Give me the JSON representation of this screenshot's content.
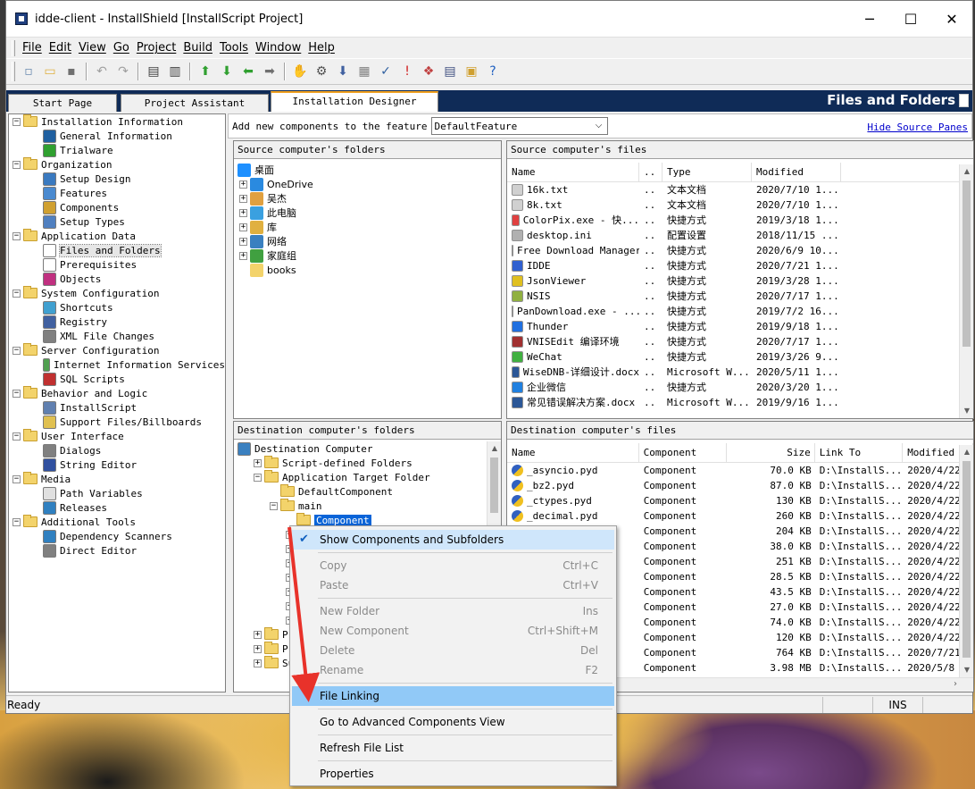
{
  "window": {
    "title": "idde-client - InstallShield [InstallScript Project]",
    "minimize": "─",
    "maximize": "☐",
    "close": "✕"
  },
  "menu": [
    "File",
    "Edit",
    "View",
    "Go",
    "Project",
    "Build",
    "Tools",
    "Window",
    "Help"
  ],
  "toolbar_icons": [
    "new-file-icon",
    "open-folder-icon",
    "save-icon",
    "undo-icon",
    "redo-icon",
    "panel-left-icon",
    "panel-split-icon",
    "arrow-up-icon",
    "arrow-down-icon",
    "arrow-left-icon",
    "arrow-right-icon",
    "hand-icon",
    "build-icon",
    "release-icon",
    "compile-icon",
    "validate-icon",
    "error-icon",
    "debug-icon",
    "options-icon",
    "package-icon",
    "help-icon"
  ],
  "tabs": {
    "start_page": "Start Page",
    "project_assistant": "Project Assistant",
    "installation_designer": "Installation Designer"
  },
  "section_title": "Files and Folders",
  "left_tree": [
    {
      "label": "Installation Information",
      "level": 0,
      "type": "folder"
    },
    {
      "label": "General Information",
      "level": 1,
      "type": "item",
      "icon": "general-info-icon",
      "color": "#2060a0"
    },
    {
      "label": "Trialware",
      "level": 1,
      "type": "item",
      "icon": "trialware-icon",
      "color": "#30a030"
    },
    {
      "label": "Organization",
      "level": 0,
      "type": "folder"
    },
    {
      "label": "Setup Design",
      "level": 1,
      "type": "item",
      "icon": "setup-design-icon",
      "color": "#3a7ac0"
    },
    {
      "label": "Features",
      "level": 1,
      "type": "item",
      "icon": "features-icon",
      "color": "#4a8ad0"
    },
    {
      "label": "Components",
      "level": 1,
      "type": "item",
      "icon": "components-icon",
      "color": "#d0a030"
    },
    {
      "label": "Setup Types",
      "level": 1,
      "type": "item",
      "icon": "setup-types-icon",
      "color": "#5080c0"
    },
    {
      "label": "Application Data",
      "level": 0,
      "type": "folder"
    },
    {
      "label": "Files and Folders",
      "level": 1,
      "type": "item",
      "icon": "files-folders-icon",
      "color": "#ffffff",
      "selected": true
    },
    {
      "label": "Prerequisites",
      "level": 1,
      "type": "item",
      "icon": "prerequisites-icon",
      "color": "#ffffff"
    },
    {
      "label": "Objects",
      "level": 1,
      "type": "item",
      "icon": "objects-icon",
      "color": "#c03080"
    },
    {
      "label": "System Configuration",
      "level": 0,
      "type": "folder"
    },
    {
      "label": "Shortcuts",
      "level": 1,
      "type": "item",
      "icon": "shortcuts-icon",
      "color": "#40a0d0"
    },
    {
      "label": "Registry",
      "level": 1,
      "type": "item",
      "icon": "registry-icon",
      "color": "#4060a0"
    },
    {
      "label": "XML File Changes",
      "level": 1,
      "type": "item",
      "icon": "xml-icon",
      "color": "#808080"
    },
    {
      "label": "Server Configuration",
      "level": 0,
      "type": "folder"
    },
    {
      "label": "Internet Information Services",
      "level": 1,
      "type": "item",
      "icon": "iis-icon",
      "color": "#50a050"
    },
    {
      "label": "SQL Scripts",
      "level": 1,
      "type": "item",
      "icon": "sql-icon",
      "color": "#c03030"
    },
    {
      "label": "Behavior and Logic",
      "level": 0,
      "type": "folder"
    },
    {
      "label": "InstallScript",
      "level": 1,
      "type": "item",
      "icon": "installscript-icon",
      "color": "#6080b0"
    },
    {
      "label": "Support Files/Billboards",
      "level": 1,
      "type": "item",
      "icon": "support-files-icon",
      "color": "#e0c050"
    },
    {
      "label": "User Interface",
      "level": 0,
      "type": "folder"
    },
    {
      "label": "Dialogs",
      "level": 1,
      "type": "item",
      "icon": "dialogs-icon",
      "color": "#808080"
    },
    {
      "label": "String Editor",
      "level": 1,
      "type": "item",
      "icon": "string-editor-icon",
      "color": "#3050a0"
    },
    {
      "label": "Media",
      "level": 0,
      "type": "folder"
    },
    {
      "label": "Path Variables",
      "level": 1,
      "type": "item",
      "icon": "path-variables-icon",
      "color": "#e0e0e0"
    },
    {
      "label": "Releases",
      "level": 1,
      "type": "item",
      "icon": "releases-icon",
      "color": "#3080c0"
    },
    {
      "label": "Additional Tools",
      "level": 0,
      "type": "folder"
    },
    {
      "label": "Dependency Scanners",
      "level": 1,
      "type": "item",
      "icon": "dependency-scanners-icon",
      "color": "#3080c0"
    },
    {
      "label": "Direct Editor",
      "level": 1,
      "type": "item",
      "icon": "direct-editor-icon",
      "color": "#808080"
    }
  ],
  "feature_bar": {
    "label": "Add new components to the feature",
    "selected": "DefaultFeature",
    "hide_link": "Hide Source Panes"
  },
  "source_folders": {
    "header": "Source computer's folders",
    "items": [
      {
        "label": "桌面",
        "level": 0,
        "expander": "",
        "icon": "desktop-icon",
        "color": "#1e90ff"
      },
      {
        "label": "OneDrive",
        "level": 1,
        "expander": "+",
        "icon": "onedrive-icon",
        "color": "#2a8ae0"
      },
      {
        "label": "吴杰",
        "level": 1,
        "expander": "+",
        "icon": "user-icon",
        "color": "#e0a040"
      },
      {
        "label": "此电脑",
        "level": 1,
        "expander": "+",
        "icon": "computer-icon",
        "color": "#3aa0e0"
      },
      {
        "label": "库",
        "level": 1,
        "expander": "+",
        "icon": "library-icon",
        "color": "#e0b040"
      },
      {
        "label": "网络",
        "level": 1,
        "expander": "+",
        "icon": "network-icon",
        "color": "#3a80c0"
      },
      {
        "label": "家庭组",
        "level": 1,
        "expander": "+",
        "icon": "homegroup-icon",
        "color": "#40a040"
      },
      {
        "label": "books",
        "level": 1,
        "expander": "",
        "icon": "folder-icon",
        "color": "#f3d36b"
      }
    ]
  },
  "source_files": {
    "header": "Source computer's files",
    "columns": [
      "Name",
      "..",
      "Type",
      "Modified"
    ],
    "rows": [
      {
        "name": "16k.txt",
        "dots": "..",
        "type": "文本文档",
        "modified": "2020/7/10 1...",
        "icon": "text-file-icon",
        "color": "#d0d0d0"
      },
      {
        "name": "8k.txt",
        "dots": "..",
        "type": "文本文档",
        "modified": "2020/7/10 1...",
        "icon": "text-file-icon",
        "color": "#d0d0d0"
      },
      {
        "name": "ColorPix.exe - 快...",
        "dots": "..",
        "type": "快捷方式",
        "modified": "2019/3/18 1...",
        "icon": "colorpix-icon",
        "color": "#e04040"
      },
      {
        "name": "desktop.ini",
        "dots": "..",
        "type": "配置设置",
        "modified": "2018/11/15 ...",
        "icon": "ini-file-icon",
        "color": "#b0b0b0"
      },
      {
        "name": "Free Download Manager",
        "dots": "..",
        "type": "快捷方式",
        "modified": "2020/6/9 10...",
        "icon": "fdm-icon",
        "color": "#ffffff"
      },
      {
        "name": "IDDE",
        "dots": "..",
        "type": "快捷方式",
        "modified": "2020/7/21 1...",
        "icon": "idde-icon",
        "color": "#3060d0"
      },
      {
        "name": "JsonViewer",
        "dots": "..",
        "type": "快捷方式",
        "modified": "2019/3/28 1...",
        "icon": "jsonviewer-icon",
        "color": "#e0c020"
      },
      {
        "name": "NSIS",
        "dots": "..",
        "type": "快捷方式",
        "modified": "2020/7/17 1...",
        "icon": "nsis-icon",
        "color": "#90b040"
      },
      {
        "name": "PanDownload.exe - ...",
        "dots": "..",
        "type": "快捷方式",
        "modified": "2019/7/2 16...",
        "icon": "pandownload-icon",
        "color": "#40a0e0"
      },
      {
        "name": "Thunder",
        "dots": "..",
        "type": "快捷方式",
        "modified": "2019/9/18 1...",
        "icon": "thunder-icon",
        "color": "#2070e0"
      },
      {
        "name": "VNISEdit 编译环境",
        "dots": "..",
        "type": "快捷方式",
        "modified": "2020/7/17 1...",
        "icon": "vnisedit-icon",
        "color": "#a03030"
      },
      {
        "name": "WeChat",
        "dots": "..",
        "type": "快捷方式",
        "modified": "2019/3/26 9...",
        "icon": "wechat-icon",
        "color": "#40b040"
      },
      {
        "name": "WiseDNB-详细设计.docx",
        "dots": "..",
        "type": "Microsoft W...",
        "modified": "2020/5/11 1...",
        "icon": "word-icon",
        "color": "#2b5797"
      },
      {
        "name": "企业微信",
        "dots": "..",
        "type": "快捷方式",
        "modified": "2020/3/20 1...",
        "icon": "wework-icon",
        "color": "#2080e0"
      },
      {
        "name": "常见错误解决方案.docx",
        "dots": "..",
        "type": "Microsoft W...",
        "modified": "2019/9/16 1...",
        "icon": "word-icon",
        "color": "#2b5797"
      }
    ]
  },
  "dest_folders": {
    "header": "Destination computer's folders",
    "items": [
      {
        "label": "Destination Computer",
        "level": 0,
        "expander": "",
        "icon": "computer-icon",
        "color": "#3a80c0"
      },
      {
        "label": "Script-defined Folders",
        "level": 1,
        "expander": "+",
        "icon": "script-folder-icon",
        "color": "#f3d36b"
      },
      {
        "label": "Application Target Folder",
        "level": 1,
        "expander": "−",
        "icon": "target-folder-icon",
        "color": "#f3d36b"
      },
      {
        "label": "DefaultComponent",
        "level": 2,
        "expander": "",
        "icon": "folder-icon",
        "color": "#f3d36b"
      },
      {
        "label": "main",
        "level": 2,
        "expander": "−",
        "icon": "folder-icon",
        "color": "#f3d36b"
      },
      {
        "label": "Component",
        "level": 3,
        "expander": "",
        "icon": "folder-icon",
        "color": "#f3d36b",
        "selected": true
      },
      {
        "label": "",
        "level": 3,
        "expander": "+",
        "icon": "component-icon",
        "color": "#e0c020"
      },
      {
        "label": "",
        "level": 3,
        "expander": "+",
        "icon": "component-icon",
        "color": "#e0c020"
      },
      {
        "label": "",
        "level": 3,
        "expander": "+",
        "icon": "component-icon",
        "color": "#e0c020"
      },
      {
        "label": "",
        "level": 3,
        "expander": "+",
        "icon": "component-icon",
        "color": "#e0c020"
      },
      {
        "label": "",
        "level": 3,
        "expander": "+",
        "icon": "component-icon",
        "color": "#e0c020"
      },
      {
        "label": "",
        "level": 3,
        "expander": "+",
        "icon": "component-icon",
        "color": "#e0c020"
      },
      {
        "label": "",
        "level": 3,
        "expander": "+",
        "icon": "component-icon",
        "color": "#e0c020"
      },
      {
        "label": "Prog",
        "level": 1,
        "expander": "+",
        "icon": "folder-icon",
        "color": "#f3d36b"
      },
      {
        "label": "Prog",
        "level": 1,
        "expander": "+",
        "icon": "folder-icon",
        "color": "#f3d36b"
      },
      {
        "label": "Supp",
        "level": 1,
        "expander": "+",
        "icon": "folder-icon",
        "color": "#f3d36b"
      }
    ]
  },
  "dest_files": {
    "header": "Destination computer's files",
    "columns": [
      "Name",
      "Component",
      "Size",
      "Link To",
      "Modified"
    ],
    "rows": [
      {
        "name": "_asyncio.pyd",
        "component": "Component",
        "size": "70.0 KB",
        "link": "D:\\InstallS...",
        "modified": "2020/4/22"
      },
      {
        "name": "_bz2.pyd",
        "component": "Component",
        "size": "87.0 KB",
        "link": "D:\\InstallS...",
        "modified": "2020/4/22"
      },
      {
        "name": "_ctypes.pyd",
        "component": "Component",
        "size": "130 KB",
        "link": "D:\\InstallS...",
        "modified": "2020/4/22"
      },
      {
        "name": "_decimal.pyd",
        "component": "Component",
        "size": "260 KB",
        "link": "D:\\InstallS...",
        "modified": "2020/4/22"
      },
      {
        "name": "",
        "component": "Component",
        "size": "204 KB",
        "link": "D:\\InstallS...",
        "modified": "2020/4/22"
      },
      {
        "name": "",
        "component": "Component",
        "size": "38.0 KB",
        "link": "D:\\InstallS...",
        "modified": "2020/4/22"
      },
      {
        "name": "",
        "component": "Component",
        "size": "251 KB",
        "link": "D:\\InstallS...",
        "modified": "2020/4/22"
      },
      {
        "name": "yd",
        "component": "Component",
        "size": "28.5 KB",
        "link": "D:\\InstallS...",
        "modified": "2020/4/22"
      },
      {
        "name": "",
        "component": "Component",
        "size": "43.5 KB",
        "link": "D:\\InstallS...",
        "modified": "2020/4/22"
      },
      {
        "name": "",
        "component": "Component",
        "size": "27.0 KB",
        "link": "D:\\InstallS...",
        "modified": "2020/4/22"
      },
      {
        "name": "",
        "component": "Component",
        "size": "74.0 KB",
        "link": "D:\\InstallS...",
        "modified": "2020/4/22"
      },
      {
        "name": "",
        "component": "Component",
        "size": "120 KB",
        "link": "D:\\InstallS...",
        "modified": "2020/4/22"
      },
      {
        "name": "",
        "component": "Component",
        "size": "764 KB",
        "link": "D:\\InstallS...",
        "modified": "2020/7/21"
      },
      {
        "name": "",
        "component": "Component",
        "size": "3.98 MB",
        "link": "D:\\InstallS...",
        "modified": "2020/5/8"
      }
    ]
  },
  "context_menu": {
    "items": [
      {
        "label": "Show Components and Subfolders",
        "shortcut": "",
        "state": "checked"
      },
      {
        "sep": true
      },
      {
        "label": "Copy",
        "shortcut": "Ctrl+C",
        "state": "disabled"
      },
      {
        "label": "Paste",
        "shortcut": "Ctrl+V",
        "state": "disabled"
      },
      {
        "sep": true
      },
      {
        "label": "New Folder",
        "shortcut": "Ins",
        "state": "disabled"
      },
      {
        "label": "New Component",
        "shortcut": "Ctrl+Shift+M",
        "state": "disabled"
      },
      {
        "label": "Delete",
        "shortcut": "Del",
        "state": "disabled"
      },
      {
        "label": "Rename",
        "shortcut": "F2",
        "state": "disabled"
      },
      {
        "sep": true
      },
      {
        "label": "File Linking",
        "shortcut": "",
        "state": "highlighted"
      },
      {
        "sep": true
      },
      {
        "label": "Go to Advanced Components View",
        "shortcut": "",
        "state": "normal"
      },
      {
        "sep": true
      },
      {
        "label": "Refresh File List",
        "shortcut": "",
        "state": "normal"
      },
      {
        "sep": true
      },
      {
        "label": "Properties",
        "shortcut": "",
        "state": "normal"
      }
    ]
  },
  "status": {
    "text": "Ready",
    "ins": "INS"
  },
  "colors": {
    "tab_strip": "#0f2b57",
    "menu_highlight": "#91c9f7",
    "annotation_arrow": "#e8322a"
  }
}
